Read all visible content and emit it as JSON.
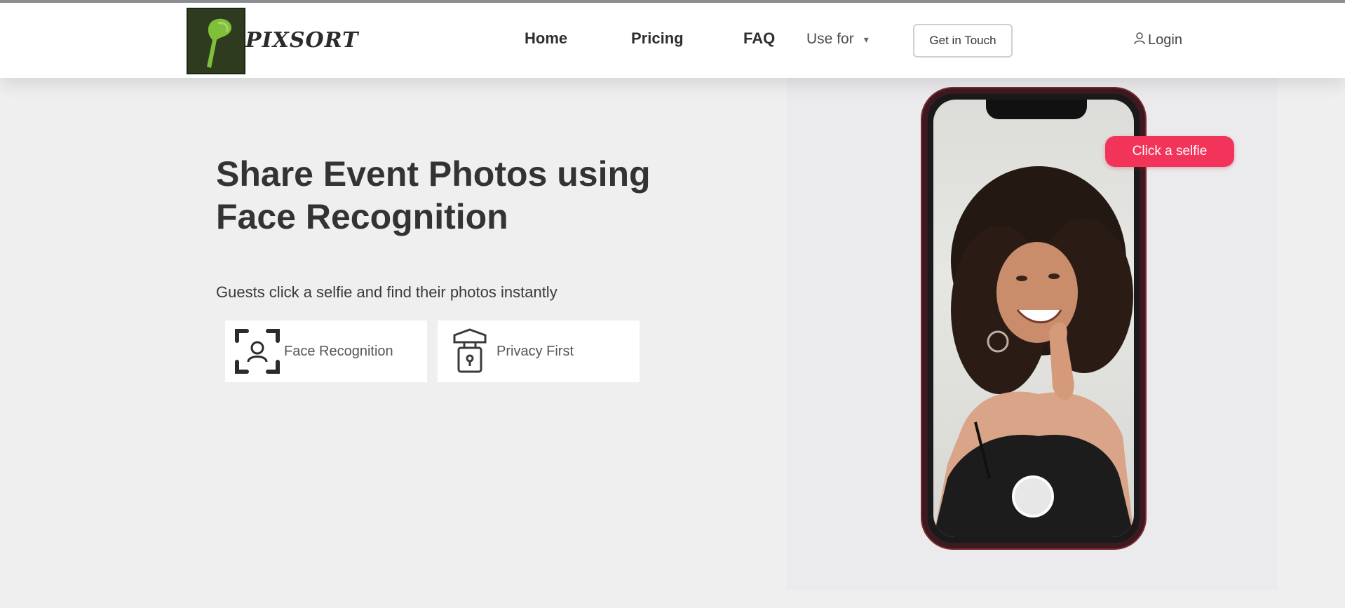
{
  "header": {
    "logo_text": "PIXSORT",
    "nav": {
      "home": "Home",
      "pricing": "Pricing",
      "faq": "FAQ",
      "use_for": "Use for"
    },
    "get_in_touch": "Get in Touch",
    "login": "Login"
  },
  "hero": {
    "title_line1": "Share Event Photos using",
    "title_line2": "Face Recognition",
    "subtitle": "Guests click a selfie and find their photos instantly",
    "features": [
      {
        "label": "Face Recognition",
        "icon": "face-scan-icon"
      },
      {
        "label": "Privacy First",
        "icon": "privacy-shield-icon"
      }
    ]
  },
  "phone": {
    "badge_label": "Click a selfie"
  },
  "colors": {
    "badge": "#f2345a",
    "phone_frame": "#3d1a1f",
    "logo_bg": "#2f3b1f",
    "logo_leaf": "#7fbf3a"
  }
}
